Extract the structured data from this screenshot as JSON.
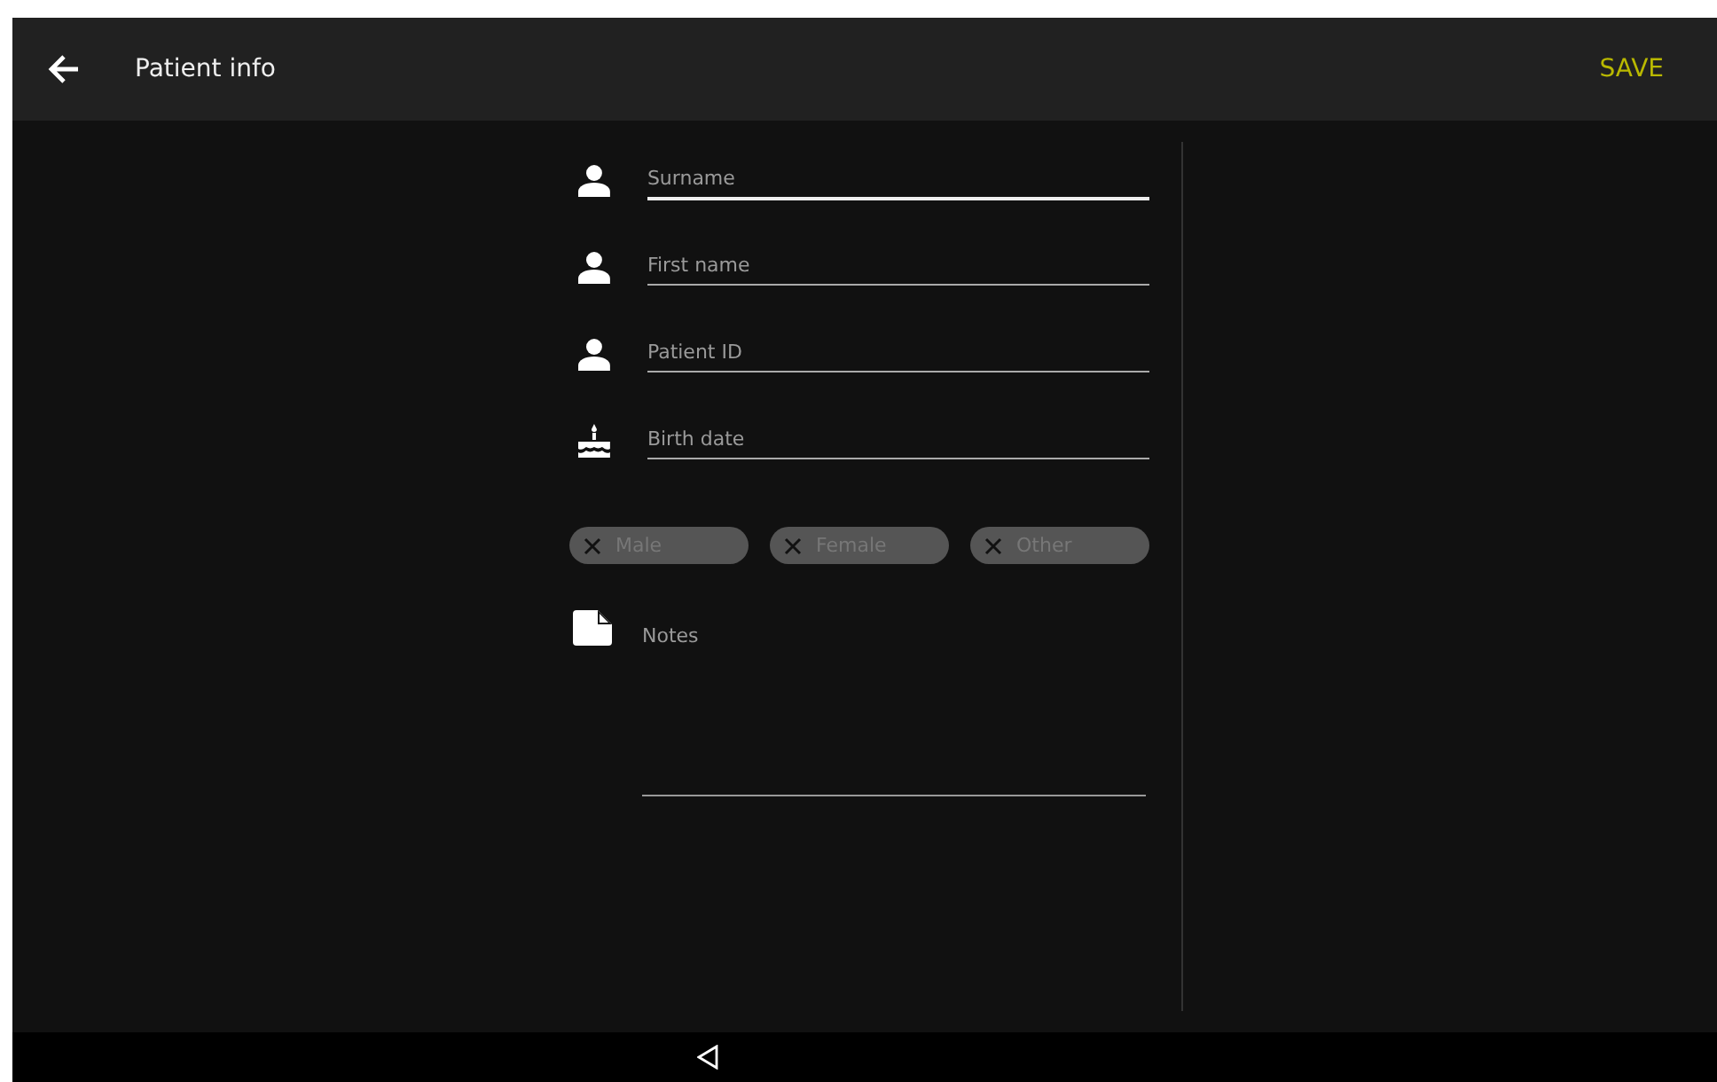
{
  "header": {
    "title": "Patient info",
    "save": "SAVE"
  },
  "fields": [
    {
      "kind": "person",
      "placeholder": "Surname",
      "focused": true
    },
    {
      "kind": "person",
      "placeholder": "First name",
      "focused": false
    },
    {
      "kind": "person",
      "placeholder": "Patient ID",
      "focused": false
    },
    {
      "kind": "cake",
      "placeholder": "Birth date",
      "focused": false
    }
  ],
  "gender_chips": [
    {
      "label": "Male",
      "selected": false
    },
    {
      "label": "Female",
      "selected": false
    },
    {
      "label": "Other",
      "selected": false
    }
  ],
  "notes": {
    "placeholder": "Notes"
  }
}
